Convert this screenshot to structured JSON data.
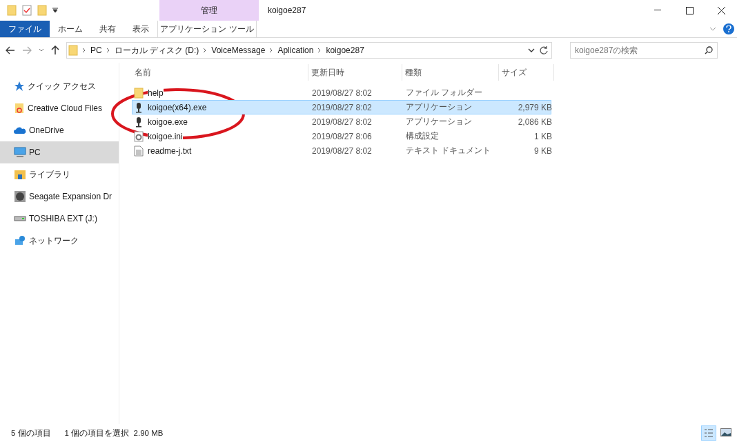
{
  "window": {
    "title": "koigoe287",
    "context_tab_group": "管理"
  },
  "ribbon_tabs": [
    {
      "label": "ファイル",
      "kind": "file",
      "selected": false
    },
    {
      "label": "ホーム",
      "kind": "tab",
      "selected": false
    },
    {
      "label": "共有",
      "kind": "tab",
      "selected": false
    },
    {
      "label": "表示",
      "kind": "tab",
      "selected": false
    },
    {
      "label": "アプリケーション ツール",
      "kind": "context",
      "selected": false
    }
  ],
  "address_bar": {
    "crumbs": [
      "PC",
      "ローカル ディスク (D:)",
      "VoiceMessage",
      "Aplication",
      "koigoe287"
    ]
  },
  "search": {
    "placeholder": "koigoe287の検索"
  },
  "sidebar": {
    "items": [
      {
        "label": "クイック アクセス",
        "kind": "star",
        "selected": false
      },
      {
        "label": "Creative Cloud Files",
        "kind": "cloudfolder",
        "selected": false
      },
      {
        "label": "OneDrive",
        "kind": "cloud",
        "selected": false
      },
      {
        "label": "PC",
        "kind": "pc",
        "selected": true
      },
      {
        "label": "ライブラリ",
        "kind": "library",
        "selected": false
      },
      {
        "label": "Seagate Expansion Dr",
        "kind": "disk",
        "selected": false
      },
      {
        "label": "TOSHIBA EXT (J:)",
        "kind": "drive",
        "selected": false
      },
      {
        "label": "ネットワーク",
        "kind": "network",
        "selected": false
      }
    ]
  },
  "table": {
    "columns": [
      "名前",
      "更新日時",
      "種類",
      "サイズ"
    ],
    "rows": [
      {
        "name": "help",
        "kind": "folder",
        "modified": "2019/08/27 8:02",
        "type": "ファイル フォルダー",
        "size": "",
        "selected": false
      },
      {
        "name": "koigoe(x64).exe",
        "kind": "app",
        "modified": "2019/08/27 8:02",
        "type": "アプリケーション",
        "size": "2,979 KB",
        "selected": true
      },
      {
        "name": "koigoe.exe",
        "kind": "app",
        "modified": "2019/08/27 8:02",
        "type": "アプリケーション",
        "size": "2,086 KB",
        "selected": false
      },
      {
        "name": "koigoe.ini",
        "kind": "config",
        "modified": "2019/08/27 8:06",
        "type": "構成設定",
        "size": "1 KB",
        "selected": false
      },
      {
        "name": "readme-j.txt",
        "kind": "text",
        "modified": "2019/08/27 8:02",
        "type": "テキスト ドキュメント",
        "size": "9 KB",
        "selected": false
      }
    ]
  },
  "status_bar": {
    "count": "5 個の項目",
    "selection": "1 個の項目を選択  2.90 MB"
  }
}
